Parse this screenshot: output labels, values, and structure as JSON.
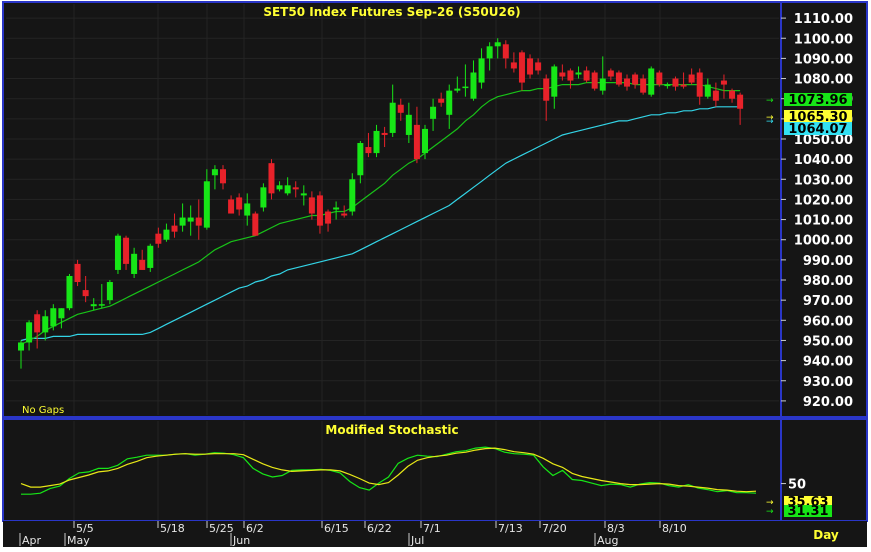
{
  "chart_data": [
    {
      "type": "candlestick",
      "title": "SET50  Index  Futures  Sep-26  (S50U26)",
      "note": "No  Gaps",
      "ylim": [
        913,
        1117
      ],
      "yticks": [
        "1110.00",
        "1100.00",
        "1090.00",
        "1080.00",
        "1070.00",
        "1060.00",
        "1050.00",
        "1040.00",
        "1030.00",
        "1020.00",
        "1010.00",
        "1000.00",
        "990.00",
        "980.00",
        "970.00",
        "960.00",
        "950.00",
        "940.00",
        "930.00",
        "920.00"
      ],
      "last_value_labels": [
        {
          "text": "1073.96",
          "value": 1074.0,
          "color": "#17e617"
        },
        {
          "text": "1065.30",
          "value": 1065.3,
          "color": "#ffff33"
        },
        {
          "text": "1064.07",
          "value": 1064.07,
          "color": "#33e0f2"
        }
      ],
      "colors": {
        "up": "#17e617",
        "down": "#e8222a",
        "ma_fast": "#18c218",
        "ma_slow": "#33d4e6"
      },
      "candles": [
        {
          "o": 945,
          "h": 950,
          "l": 936,
          "c": 949
        },
        {
          "o": 949,
          "h": 960,
          "l": 945,
          "c": 959
        },
        {
          "o": 963,
          "h": 965,
          "l": 946,
          "c": 954
        },
        {
          "o": 954,
          "h": 965,
          "l": 950,
          "c": 962
        },
        {
          "o": 957,
          "h": 968,
          "l": 955,
          "c": 966
        },
        {
          "o": 961,
          "h": 966,
          "l": 956,
          "c": 966
        },
        {
          "o": 966,
          "h": 983,
          "l": 965,
          "c": 982
        },
        {
          "o": 988,
          "h": 990,
          "l": 977,
          "c": 979
        },
        {
          "o": 975,
          "h": 982,
          "l": 969,
          "c": 972
        },
        {
          "o": 967,
          "h": 971,
          "l": 965,
          "c": 968
        },
        {
          "o": 968,
          "h": 978,
          "l": 966,
          "c": 968
        },
        {
          "o": 970,
          "h": 980,
          "l": 968,
          "c": 979
        },
        {
          "o": 985,
          "h": 1003,
          "l": 983,
          "c": 1002
        },
        {
          "o": 1001,
          "h": 1002,
          "l": 985,
          "c": 988
        },
        {
          "o": 983,
          "h": 996,
          "l": 981,
          "c": 993
        },
        {
          "o": 990,
          "h": 995,
          "l": 985,
          "c": 985
        },
        {
          "o": 986,
          "h": 998,
          "l": 984,
          "c": 997
        },
        {
          "o": 1003,
          "h": 1006,
          "l": 996,
          "c": 998
        },
        {
          "o": 1000,
          "h": 1008,
          "l": 999,
          "c": 1005
        },
        {
          "o": 1007,
          "h": 1013,
          "l": 1001,
          "c": 1004
        },
        {
          "o": 1007,
          "h": 1018,
          "l": 1004,
          "c": 1011
        },
        {
          "o": 1009,
          "h": 1017,
          "l": 1002,
          "c": 1011
        },
        {
          "o": 1011,
          "h": 1020,
          "l": 1000,
          "c": 1007
        },
        {
          "o": 1006,
          "h": 1035,
          "l": 1005,
          "c": 1029
        },
        {
          "o": 1032,
          "h": 1037,
          "l": 1025,
          "c": 1035
        },
        {
          "o": 1035,
          "h": 1037,
          "l": 1025,
          "c": 1028
        },
        {
          "o": 1020,
          "h": 1022,
          "l": 1013,
          "c": 1013
        },
        {
          "o": 1021,
          "h": 1023,
          "l": 1012,
          "c": 1015
        },
        {
          "o": 1012,
          "h": 1023,
          "l": 1007,
          "c": 1018
        },
        {
          "o": 1013,
          "h": 1014,
          "l": 1002,
          "c": 1002
        },
        {
          "o": 1016,
          "h": 1028,
          "l": 1014,
          "c": 1026
        },
        {
          "o": 1038,
          "h": 1040,
          "l": 1020,
          "c": 1023
        },
        {
          "o": 1025,
          "h": 1029,
          "l": 1024,
          "c": 1027
        },
        {
          "o": 1023,
          "h": 1031,
          "l": 1022,
          "c": 1027
        },
        {
          "o": 1026,
          "h": 1029,
          "l": 1021,
          "c": 1025
        },
        {
          "o": 1022,
          "h": 1027,
          "l": 1017,
          "c": 1023
        },
        {
          "o": 1021,
          "h": 1024,
          "l": 1010,
          "c": 1013
        },
        {
          "o": 1022,
          "h": 1024,
          "l": 1003,
          "c": 1007
        },
        {
          "o": 1014,
          "h": 1015,
          "l": 1004,
          "c": 1008
        },
        {
          "o": 1015,
          "h": 1019,
          "l": 1010,
          "c": 1016
        },
        {
          "o": 1013,
          "h": 1017,
          "l": 1011,
          "c": 1012
        },
        {
          "o": 1014,
          "h": 1033,
          "l": 1012,
          "c": 1030
        },
        {
          "o": 1032,
          "h": 1049,
          "l": 1028,
          "c": 1048
        },
        {
          "o": 1046,
          "h": 1053,
          "l": 1041,
          "c": 1043
        },
        {
          "o": 1043,
          "h": 1057,
          "l": 1041,
          "c": 1054
        },
        {
          "o": 1053,
          "h": 1056,
          "l": 1046,
          "c": 1052
        },
        {
          "o": 1053,
          "h": 1077,
          "l": 1051,
          "c": 1068
        },
        {
          "o": 1067,
          "h": 1070,
          "l": 1059,
          "c": 1063
        },
        {
          "o": 1052,
          "h": 1068,
          "l": 1048,
          "c": 1062
        },
        {
          "o": 1057,
          "h": 1066,
          "l": 1038,
          "c": 1040
        },
        {
          "o": 1043,
          "h": 1057,
          "l": 1040,
          "c": 1055
        },
        {
          "o": 1060,
          "h": 1070,
          "l": 1054,
          "c": 1066
        },
        {
          "o": 1070,
          "h": 1073,
          "l": 1066,
          "c": 1068
        },
        {
          "o": 1062,
          "h": 1077,
          "l": 1055,
          "c": 1074
        },
        {
          "o": 1074,
          "h": 1081,
          "l": 1073,
          "c": 1075
        },
        {
          "o": 1076,
          "h": 1087,
          "l": 1071,
          "c": 1076
        },
        {
          "o": 1070,
          "h": 1089,
          "l": 1069,
          "c": 1083
        },
        {
          "o": 1078,
          "h": 1095,
          "l": 1075,
          "c": 1090
        },
        {
          "o": 1090,
          "h": 1098,
          "l": 1084,
          "c": 1096
        },
        {
          "o": 1096,
          "h": 1100,
          "l": 1090,
          "c": 1098
        },
        {
          "o": 1097,
          "h": 1099,
          "l": 1085,
          "c": 1090
        },
        {
          "o": 1088,
          "h": 1093,
          "l": 1083,
          "c": 1085
        },
        {
          "o": 1093,
          "h": 1094,
          "l": 1074,
          "c": 1078
        },
        {
          "o": 1090,
          "h": 1092,
          "l": 1080,
          "c": 1082
        },
        {
          "o": 1088,
          "h": 1090,
          "l": 1082,
          "c": 1084
        },
        {
          "o": 1080,
          "h": 1082,
          "l": 1059,
          "c": 1069
        },
        {
          "o": 1071,
          "h": 1087,
          "l": 1065,
          "c": 1086
        },
        {
          "o": 1083,
          "h": 1087,
          "l": 1079,
          "c": 1081
        },
        {
          "o": 1084,
          "h": 1085,
          "l": 1075,
          "c": 1079
        },
        {
          "o": 1082,
          "h": 1086,
          "l": 1080,
          "c": 1083
        },
        {
          "o": 1084,
          "h": 1086,
          "l": 1078,
          "c": 1079
        },
        {
          "o": 1083,
          "h": 1084,
          "l": 1074,
          "c": 1075
        },
        {
          "o": 1074,
          "h": 1091,
          "l": 1072,
          "c": 1080
        },
        {
          "o": 1084,
          "h": 1085,
          "l": 1079,
          "c": 1081
        },
        {
          "o": 1083,
          "h": 1084,
          "l": 1076,
          "c": 1077
        },
        {
          "o": 1080,
          "h": 1082,
          "l": 1074,
          "c": 1076
        },
        {
          "o": 1082,
          "h": 1083,
          "l": 1075,
          "c": 1077
        },
        {
          "o": 1080,
          "h": 1082,
          "l": 1072,
          "c": 1073
        },
        {
          "o": 1072,
          "h": 1086,
          "l": 1071,
          "c": 1085
        },
        {
          "o": 1083,
          "h": 1084,
          "l": 1076,
          "c": 1077
        },
        {
          "o": 1077,
          "h": 1078,
          "l": 1075,
          "c": 1077
        },
        {
          "o": 1080,
          "h": 1081,
          "l": 1074,
          "c": 1076
        },
        {
          "o": 1077,
          "h": 1083,
          "l": 1075,
          "c": 1076
        },
        {
          "o": 1082,
          "h": 1085,
          "l": 1077,
          "c": 1078
        },
        {
          "o": 1083,
          "h": 1085,
          "l": 1067,
          "c": 1071
        },
        {
          "o": 1071,
          "h": 1080,
          "l": 1070,
          "c": 1077
        },
        {
          "o": 1074,
          "h": 1078,
          "l": 1066,
          "c": 1069
        },
        {
          "o": 1079,
          "h": 1082,
          "l": 1070,
          "c": 1077
        },
        {
          "o": 1074,
          "h": 1075,
          "l": 1068,
          "c": 1070
        },
        {
          "o": 1072,
          "h": 1073,
          "l": 1057,
          "c": 1065
        }
      ],
      "ma_fast": [
        948,
        950,
        952,
        955,
        957,
        959,
        961,
        963,
        964,
        965,
        966,
        967,
        969,
        971,
        973,
        975,
        977,
        979,
        981,
        983,
        985,
        987,
        989,
        992,
        995,
        997,
        999,
        1000,
        1001,
        1002,
        1004,
        1006,
        1008,
        1009,
        1010,
        1011,
        1012,
        1012,
        1013,
        1014,
        1014,
        1016,
        1019,
        1022,
        1025,
        1028,
        1032,
        1035,
        1038,
        1040,
        1043,
        1046,
        1049,
        1052,
        1055,
        1059,
        1062,
        1066,
        1069,
        1071,
        1072,
        1073,
        1074,
        1074,
        1075,
        1075,
        1076,
        1077,
        1077,
        1077,
        1078,
        1078,
        1078,
        1078,
        1078,
        1078,
        1077,
        1077,
        1077,
        1077,
        1077,
        1077,
        1077,
        1077,
        1077,
        1076,
        1075,
        1074,
        1074,
        1074
      ],
      "ma_slow": [
        950,
        951,
        951,
        951,
        952,
        952,
        952,
        953,
        953,
        953,
        953,
        953,
        953,
        953,
        953,
        953,
        954,
        956,
        958,
        960,
        962,
        964,
        966,
        968,
        970,
        972,
        974,
        976,
        977,
        979,
        980,
        982,
        983,
        985,
        986,
        987,
        988,
        989,
        990,
        991,
        992,
        993,
        995,
        997,
        999,
        1001,
        1003,
        1005,
        1007,
        1009,
        1011,
        1013,
        1015,
        1017,
        1020,
        1023,
        1026,
        1029,
        1032,
        1035,
        1038,
        1040,
        1042,
        1044,
        1046,
        1048,
        1050,
        1052,
        1053,
        1054,
        1055,
        1056,
        1057,
        1058,
        1059,
        1059,
        1060,
        1061,
        1062,
        1062,
        1063,
        1063,
        1064,
        1064,
        1065,
        1065,
        1066,
        1066,
        1066,
        1066
      ]
    },
    {
      "type": "line",
      "title": "Modified  Stochastic",
      "ylim": [
        -20,
        140
      ],
      "yticks": [
        "50"
      ],
      "last_value_labels": [
        {
          "text": "35.63",
          "value": 36,
          "color": "#ffff33"
        },
        {
          "text": "31.31",
          "value": 31,
          "color": "#17e617"
        }
      ],
      "series": [
        {
          "color": "#17e617",
          "values": [
            29,
            29,
            31,
            40,
            45,
            60,
            71,
            73,
            80,
            80,
            86,
            99,
            102,
            106,
            106,
            106,
            108,
            109,
            106,
            108,
            111,
            110,
            107,
            101,
            80,
            69,
            63,
            66,
            76,
            77,
            77,
            78,
            76,
            71,
            54,
            42,
            37,
            51,
            63,
            90,
            100,
            106,
            104,
            103,
            108,
            113,
            115,
            120,
            122,
            119,
            112,
            109,
            108,
            106,
            83,
            66,
            76,
            58,
            56,
            51,
            46,
            49,
            48,
            43,
            49,
            52,
            51,
            46,
            43,
            48,
            41,
            38,
            34,
            36,
            32,
            32,
            31
          ]
        },
        {
          "color": "#e8e817",
          "values": [
            50,
            43,
            43,
            46,
            49,
            57,
            62,
            67,
            73,
            75,
            80,
            88,
            94,
            101,
            104,
            106,
            108,
            109,
            108,
            108,
            109,
            109,
            109,
            107,
            98,
            89,
            82,
            77,
            74,
            75,
            76,
            77,
            77,
            75,
            68,
            60,
            51,
            48,
            52,
            67,
            84,
            96,
            101,
            104,
            106,
            110,
            112,
            116,
            119,
            120,
            117,
            113,
            111,
            108,
            100,
            89,
            82,
            70,
            64,
            60,
            56,
            53,
            50,
            48,
            48,
            49,
            50,
            49,
            46,
            45,
            43,
            41,
            38,
            37,
            35,
            34,
            35
          ]
        }
      ]
    }
  ],
  "x_axis": {
    "dates": [
      "5/5",
      "5/18",
      "5/25",
      "6/2",
      "6/15",
      "6/22",
      "7/1",
      "7/13",
      "7/20",
      "8/3",
      "8/10"
    ],
    "months": [
      "Apr",
      "May",
      "Jun",
      "Jul",
      "Aug"
    ],
    "period_button": "Day"
  }
}
